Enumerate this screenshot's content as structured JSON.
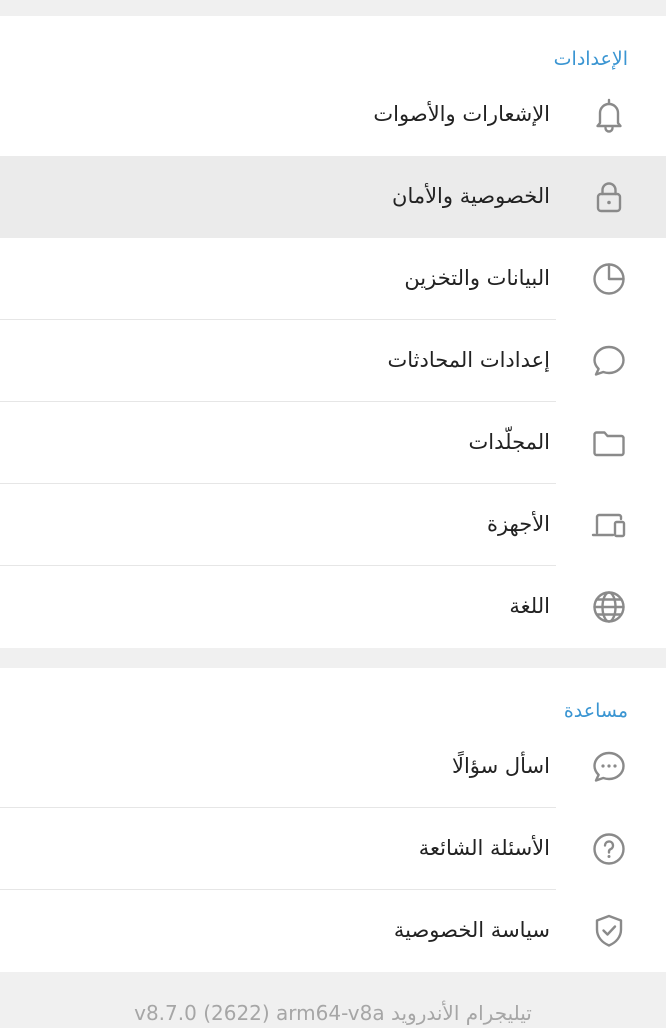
{
  "settings": {
    "header": "الإعدادات",
    "items": [
      {
        "label": "الإشعارات والأصوات",
        "icon": "bell-icon"
      },
      {
        "label": "الخصوصية والأمان",
        "icon": "lock-icon"
      },
      {
        "label": "البيانات والتخزين",
        "icon": "pie-chart-icon"
      },
      {
        "label": "إعدادات المحادثات",
        "icon": "chat-bubble-icon"
      },
      {
        "label": "المجلّدات",
        "icon": "folder-icon"
      },
      {
        "label": "الأجهزة",
        "icon": "devices-icon"
      },
      {
        "label": "اللغة",
        "icon": "globe-icon"
      }
    ]
  },
  "help": {
    "header": "مساعدة",
    "items": [
      {
        "label": "اسأل سؤالًا",
        "icon": "chat-dots-icon"
      },
      {
        "label": "الأسئلة الشائعة",
        "icon": "question-icon"
      },
      {
        "label": "سياسة الخصوصية",
        "icon": "shield-check-icon"
      }
    ]
  },
  "footer": {
    "version": "تيليجرام الأندرويد v8.7.0 (2622) arm64-v8a"
  },
  "colors": {
    "accent": "#3a95d2",
    "highlight": "#ebebeb",
    "background": "#f0f0f0",
    "icon": "#8a8a8a"
  }
}
